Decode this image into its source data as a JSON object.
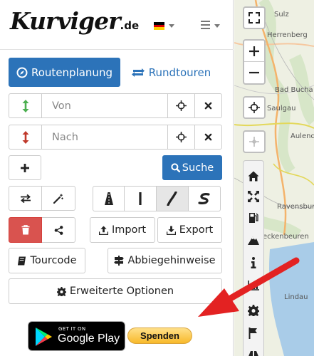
{
  "header": {
    "logo_text": "Kurviger",
    "logo_tld": ".de",
    "language": "de",
    "flag_colors": [
      "#000000",
      "#dd0000",
      "#ffce00"
    ]
  },
  "tabs": {
    "route_planning": "Routenplanung",
    "round_trips": "Rundtouren"
  },
  "inputs": {
    "from_placeholder": "Von",
    "to_placeholder": "Nach"
  },
  "buttons": {
    "search": "Suche",
    "import": "Import",
    "export": "Export",
    "tourcode": "Tourcode",
    "turn_instructions": "Abbiegehinweise",
    "advanced_options": "Erweiterte Optionen",
    "donate": "Spenden"
  },
  "google_play": {
    "small": "GET IT ON",
    "big": "Google Play"
  },
  "map": {
    "labels": [
      "Sulz",
      "Herrenberg",
      "Bad Bucha",
      "Saulgau",
      "Aulend",
      "Ravensbur",
      "eckenbeuren",
      "Lindau"
    ]
  },
  "colors": {
    "primary": "#2c73b9",
    "danger": "#d9534f",
    "from_arrow": "#4caf50",
    "to_arrow": "#c0392b"
  },
  "icons": [
    "explore-icon",
    "round-trip-icon",
    "up-down-arrow-icon",
    "crosshair-icon",
    "close-icon",
    "plus-icon",
    "search-icon",
    "swap-icon",
    "magic-wand-icon",
    "trash-icon",
    "share-icon",
    "upload-icon",
    "download-icon",
    "book-icon",
    "signpost-icon",
    "gear-icon",
    "fullscreen-icon",
    "zoom-in-icon",
    "zoom-out-icon",
    "locate-icon",
    "home-icon",
    "fuel-icon",
    "info-icon",
    "flag-icon",
    "red-arrow-annotation"
  ]
}
